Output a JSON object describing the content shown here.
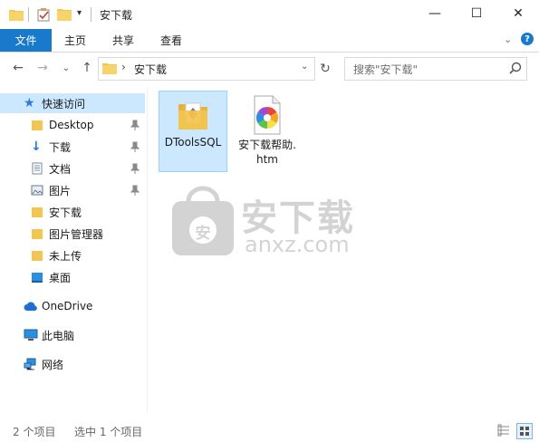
{
  "window": {
    "title": "安下载",
    "controls": {
      "minimize": "—",
      "maximize": "☐",
      "close": "✕"
    }
  },
  "ribbon": {
    "tabs": [
      {
        "label": "文件",
        "active": true
      },
      {
        "label": "主页"
      },
      {
        "label": "共享"
      },
      {
        "label": "查看"
      }
    ]
  },
  "address": {
    "path": [
      "安下载"
    ],
    "search_placeholder": "搜索\"安下载\""
  },
  "sidebar": {
    "quick_access": "快速访问",
    "quick_items": [
      {
        "label": "Desktop",
        "icon": "folder-icon",
        "pinned": true
      },
      {
        "label": "下载",
        "icon": "download-icon",
        "pinned": true
      },
      {
        "label": "文档",
        "icon": "document-icon",
        "pinned": true
      },
      {
        "label": "图片",
        "icon": "picture-icon",
        "pinned": true
      },
      {
        "label": "安下载",
        "icon": "folder-icon",
        "pinned": false
      },
      {
        "label": "图片管理器",
        "icon": "folder-icon",
        "pinned": false
      },
      {
        "label": "未上传",
        "icon": "folder-icon",
        "pinned": false
      },
      {
        "label": "桌面",
        "icon": "desktop-icon",
        "pinned": false
      }
    ],
    "onedrive": "OneDrive",
    "this_pc": "此电脑",
    "network": "网络"
  },
  "files": [
    {
      "name": "DToolsSQL",
      "type": "folder",
      "selected": true
    },
    {
      "name": "安下载帮助.htm",
      "type": "htm",
      "selected": false
    }
  ],
  "status": {
    "count": "2 个项目",
    "selected": "选中 1 个项目"
  },
  "watermark": {
    "text": "安下载",
    "sub": "anxz.com",
    "badge": "安"
  },
  "colors": {
    "accent": "#1979ca",
    "selection": "#cce8ff",
    "folder": "#f3c650"
  }
}
